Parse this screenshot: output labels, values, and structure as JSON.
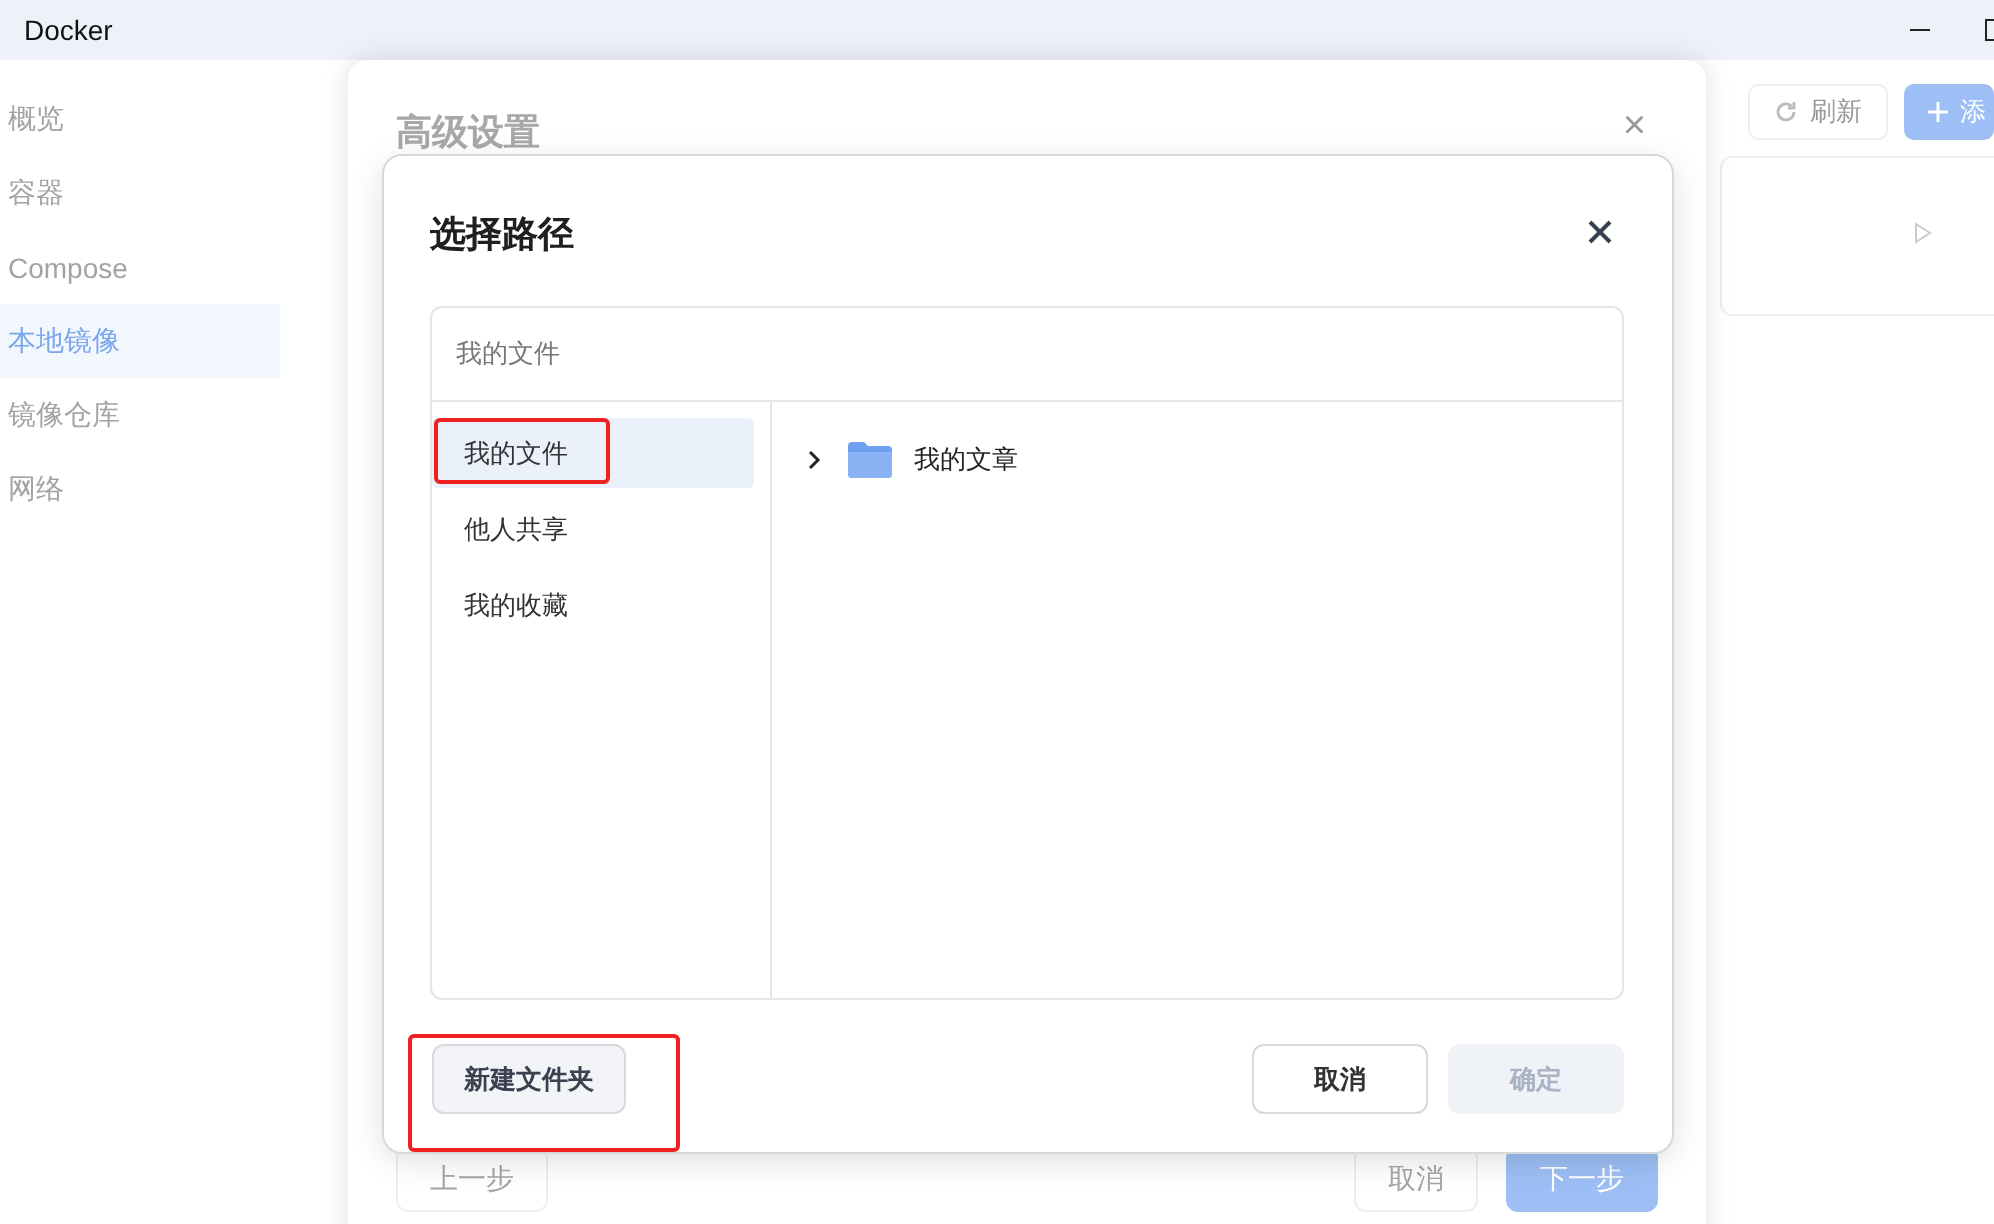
{
  "window": {
    "title": "Docker"
  },
  "sidebar": {
    "items": [
      {
        "label": "概览",
        "selected": false
      },
      {
        "label": "容器",
        "selected": false
      },
      {
        "label": "Compose",
        "selected": false
      },
      {
        "label": "本地镜像",
        "selected": true
      },
      {
        "label": "镜像仓库",
        "selected": false
      },
      {
        "label": "网络",
        "selected": false
      }
    ]
  },
  "main": {
    "toolbar": [
      {
        "label": "刷新",
        "kind": "refresh"
      },
      {
        "label": "添",
        "kind": "add"
      }
    ]
  },
  "settings_dialog": {
    "title": "高级设置",
    "close": "×",
    "buttons": [
      {
        "label": "上一步",
        "kind": "default"
      },
      {
        "label": "取消",
        "kind": "default"
      },
      {
        "label": "下一步",
        "kind": "primary"
      }
    ]
  },
  "path_dialog": {
    "title": "选择路径",
    "path": "我的文件",
    "locations": [
      {
        "label": "我的文件",
        "selected": true,
        "highlighted": true
      },
      {
        "label": "他人共享",
        "selected": false,
        "highlighted": false
      },
      {
        "label": "我的收藏",
        "selected": false,
        "highlighted": false
      }
    ],
    "folders": [
      {
        "name": "我的文章",
        "expanded": false
      }
    ],
    "buttons": [
      {
        "label": "新建文件夹",
        "kind": "default",
        "disabled": false,
        "highlighted": true
      },
      {
        "label": "取消",
        "kind": "default",
        "disabled": false,
        "highlighted": false
      },
      {
        "label": "确定",
        "kind": "primary",
        "disabled": true,
        "highlighted": false
      }
    ]
  }
}
